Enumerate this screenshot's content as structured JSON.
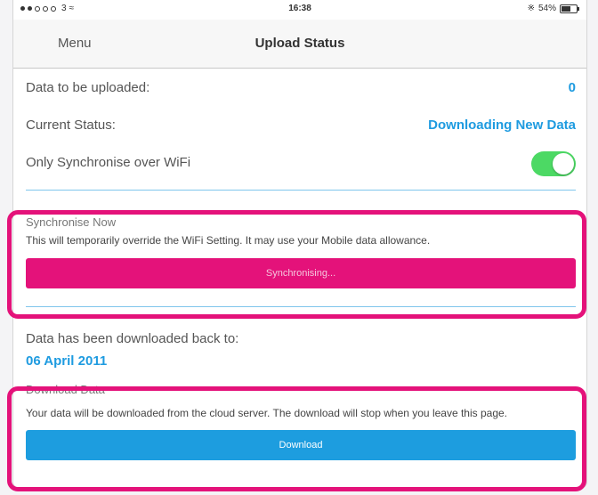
{
  "status_bar": {
    "carrier": "3",
    "time": "16:38",
    "battery": "54%"
  },
  "nav": {
    "menu_label": "Menu",
    "title": "Upload Status"
  },
  "rows": {
    "data_to_upload_label": "Data to be uploaded:",
    "data_to_upload_value": "0",
    "current_status_label": "Current Status:",
    "current_status_value": "Downloading New Data",
    "wifi_only_label": "Only Synchronise over WiFi",
    "wifi_only_enabled": true
  },
  "sync_section": {
    "title": "Synchronise Now",
    "description": "This will temporarily override the WiFi Setting.  It may use your Mobile data allowance.",
    "button_label": "Synchronising..."
  },
  "downloaded_back": {
    "label": "Data has been downloaded back to:",
    "date": "06 April 2011"
  },
  "download_section": {
    "title": "Download Data",
    "description": "Your data will be downloaded from the cloud server. The download will stop when you leave this page.",
    "button_label": "Download"
  },
  "colors": {
    "accent_blue": "#1e9be0",
    "highlight_pink": "#e4127a",
    "toggle_green": "#4cd964"
  }
}
